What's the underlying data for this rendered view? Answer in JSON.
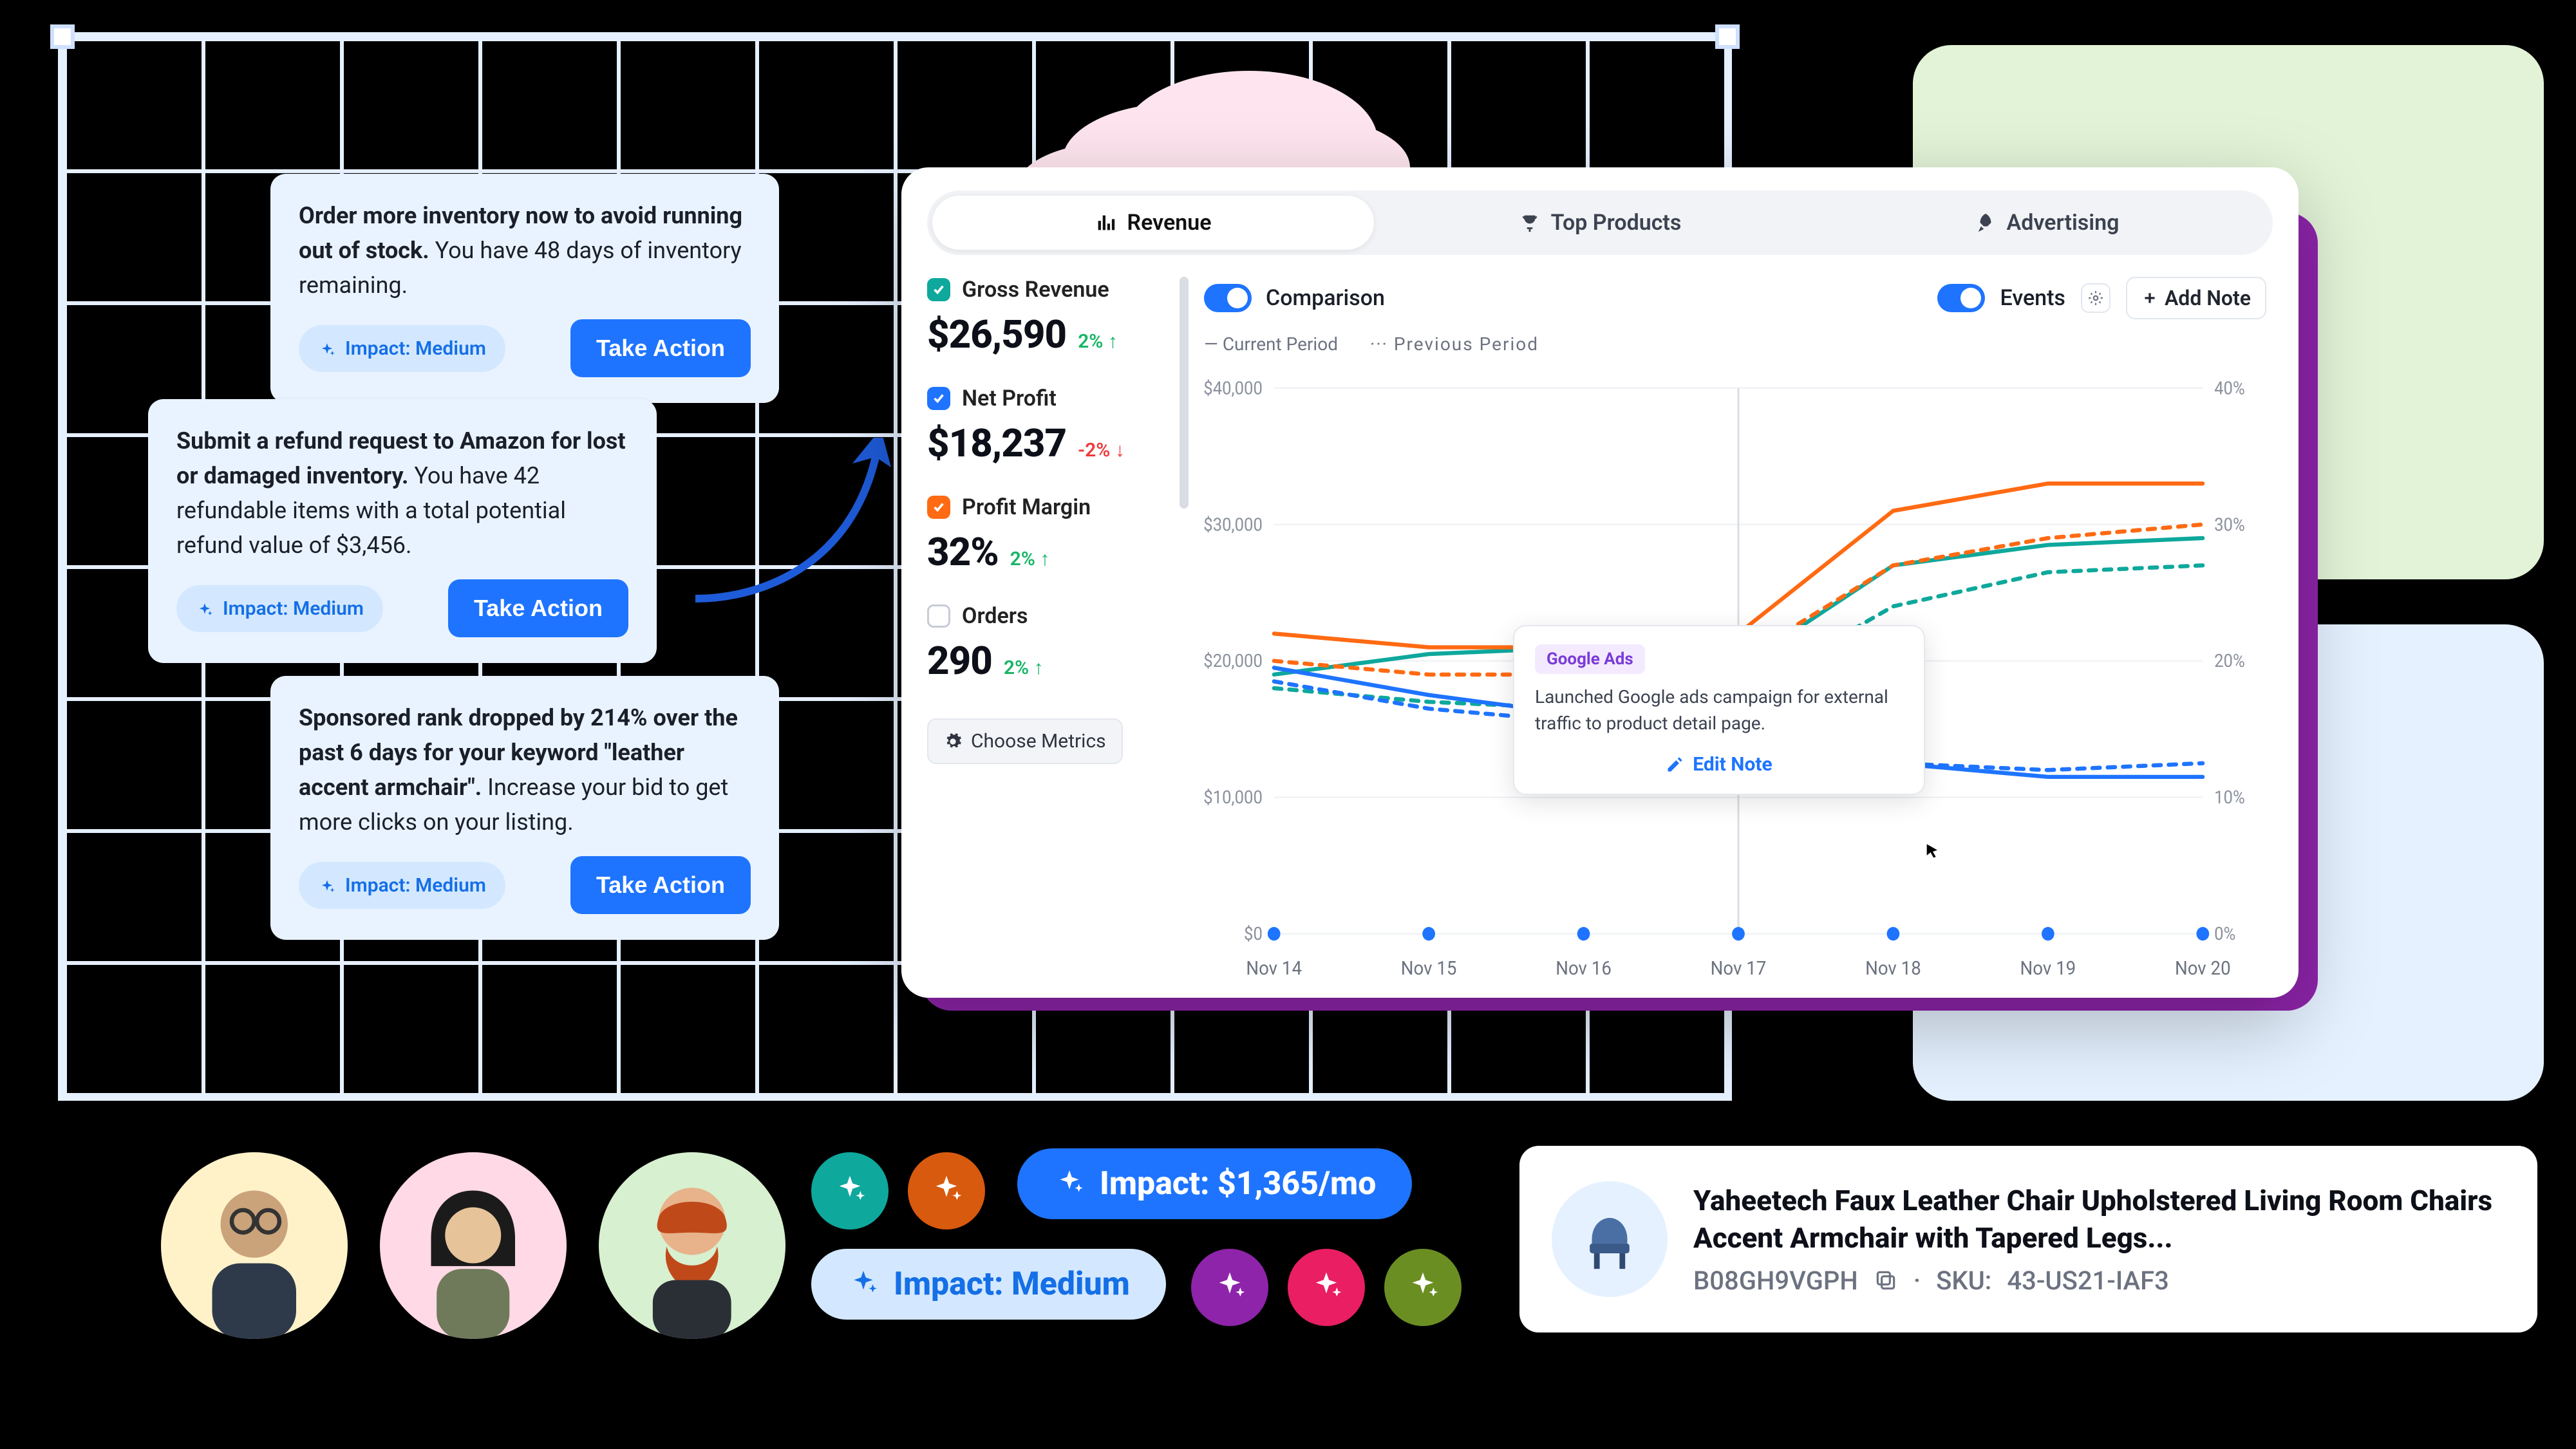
{
  "recs": [
    {
      "bold": "Order more inventory now to avoid running out of stock.",
      "rest": " You have 48 days of inventory remaining.",
      "impact": "Impact: Medium",
      "action": "Take Action"
    },
    {
      "bold": "Submit a refund request to Amazon for lost or damaged inventory.",
      "rest": " You have 42 refundable items with a total potential refund value of $3,456.",
      "impact": "Impact: Medium",
      "action": "Take Action"
    },
    {
      "bold": "Sponsored rank dropped by 214% over the past 6 days for your keyword \"leather accent armchair\".",
      "rest": " Increase your bid to get more clicks on your listing.",
      "impact": "Impact: Medium",
      "action": "Take Action"
    }
  ],
  "panel": {
    "tabs": {
      "revenue": "Revenue",
      "top_products": "Top Products",
      "advertising": "Advertising"
    },
    "controls": {
      "comparison": "Comparison",
      "events": "Events",
      "add_note": "Add Note",
      "legend_current": "Current Period",
      "legend_previous": "Previous Period",
      "choose_metrics": "Choose Metrics"
    },
    "metrics": {
      "gross_revenue": {
        "name": "Gross Revenue",
        "value": "$26,590",
        "delta": "2%",
        "dir": "up"
      },
      "net_profit": {
        "name": "Net Profit",
        "value": "$18,237",
        "delta": "-2%",
        "dir": "down"
      },
      "profit_margin": {
        "name": "Profit Margin",
        "value": "32%",
        "delta": "2%",
        "dir": "up"
      },
      "orders": {
        "name": "Orders",
        "value": "290",
        "delta": "2%",
        "dir": "up"
      }
    },
    "tooltip": {
      "tag": "Google Ads",
      "desc": "Launched Google ads campaign for external traffic to product detail page.",
      "edit": "Edit Note"
    }
  },
  "chart_data": {
    "type": "line",
    "categories": [
      "Nov 14",
      "Nov 15",
      "Nov 16",
      "Nov 17",
      "Nov 18",
      "Nov 19",
      "Nov 20"
    ],
    "y_left": {
      "label": "",
      "ticks": [
        "$0",
        "$10,000",
        "$20,000",
        "$30,000",
        "$40,000"
      ],
      "range": [
        0,
        40000
      ]
    },
    "y_right": {
      "label": "",
      "ticks": [
        "0%",
        "10%",
        "20%",
        "30%",
        "40%"
      ],
      "range": [
        0,
        40
      ]
    },
    "series": [
      {
        "name": "Gross Revenue – Current",
        "axis": "left",
        "style": "solid",
        "color": "#0ea89c",
        "values": [
          19000,
          20500,
          21000,
          19500,
          27000,
          28500,
          29000
        ]
      },
      {
        "name": "Gross Revenue – Previous",
        "axis": "left",
        "style": "dashed",
        "color": "#0ea89c",
        "values": [
          18000,
          17000,
          16500,
          17500,
          24000,
          26500,
          27000
        ]
      },
      {
        "name": "Net Profit – Current",
        "axis": "left",
        "style": "solid",
        "color": "#1e74ff",
        "values": [
          19500,
          17500,
          16000,
          14500,
          12500,
          11500,
          11500
        ]
      },
      {
        "name": "Net Profit – Previous",
        "axis": "left",
        "style": "dashed",
        "color": "#1e74ff",
        "values": [
          18500,
          16500,
          15500,
          15000,
          12500,
          12000,
          12500
        ]
      },
      {
        "name": "Profit Margin – Current",
        "axis": "right",
        "style": "solid",
        "color": "#ff6a13",
        "values": [
          22,
          21,
          21,
          22,
          31,
          33,
          33
        ]
      },
      {
        "name": "Profit Margin – Previous",
        "axis": "right",
        "style": "dashed",
        "color": "#ff6a13",
        "values": [
          20,
          19,
          19,
          20,
          27,
          29,
          30
        ]
      }
    ],
    "events": [
      "Nov 14",
      "Nov 15",
      "Nov 16",
      "Nov 17",
      "Nov 18",
      "Nov 19",
      "Nov 20"
    ]
  },
  "bottom": {
    "impact_dollar": "Impact: $1,365/mo",
    "impact_medium": "Impact: Medium"
  },
  "product": {
    "title": "Yaheetech Faux Leather Chair Upholstered Living Room Chairs Accent Armchair with Tapered Legs...",
    "asin": "B08GH9VGPH",
    "sep": "·",
    "sku_label": "SKU:",
    "sku": "43-US21-IAF3"
  },
  "colors": {
    "blue": "#1e74ff",
    "teal": "#0ea89c",
    "orange": "#ff6a13",
    "purple": "#8e24aa"
  }
}
